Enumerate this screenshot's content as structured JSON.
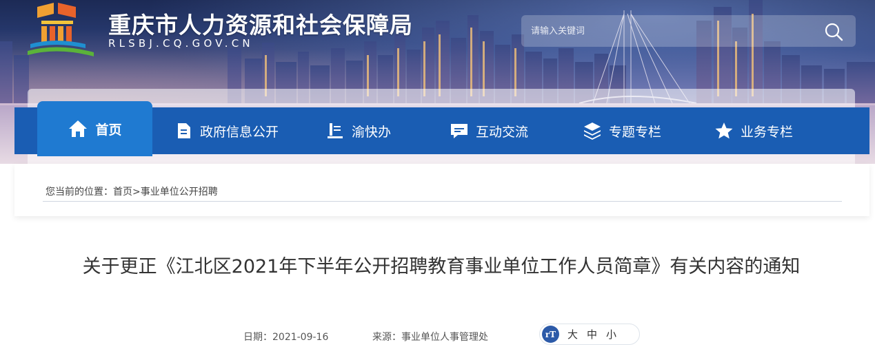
{
  "header": {
    "site_title": "重庆市人力资源和社会保障局",
    "site_domain": "RLSBJ.CQ.GOV.CN",
    "search_placeholder": "请输入关键词"
  },
  "nav": {
    "home": "首页",
    "items": [
      "政府信息公开",
      "渝快办",
      "互动交流",
      "专题专栏",
      "业务专栏"
    ]
  },
  "breadcrumb": {
    "prefix": "您当前的位置：",
    "home": "首页",
    "separator": ">",
    "current": "事业单位公开招聘"
  },
  "article": {
    "title": "关于更正《江北区2021年下半年公开招聘教育事业单位工作人员简章》有关内容的通知",
    "date_label": "日期：2021-09-16",
    "source_label": "来源：事业单位人事管理处",
    "font_size_icon": "rT",
    "font_sizes": [
      "大",
      "中",
      "小"
    ]
  },
  "colors": {
    "nav_bg": "#1a5db3",
    "nav_active": "#1f7ad1",
    "font_icon": "#2c5aa8"
  }
}
